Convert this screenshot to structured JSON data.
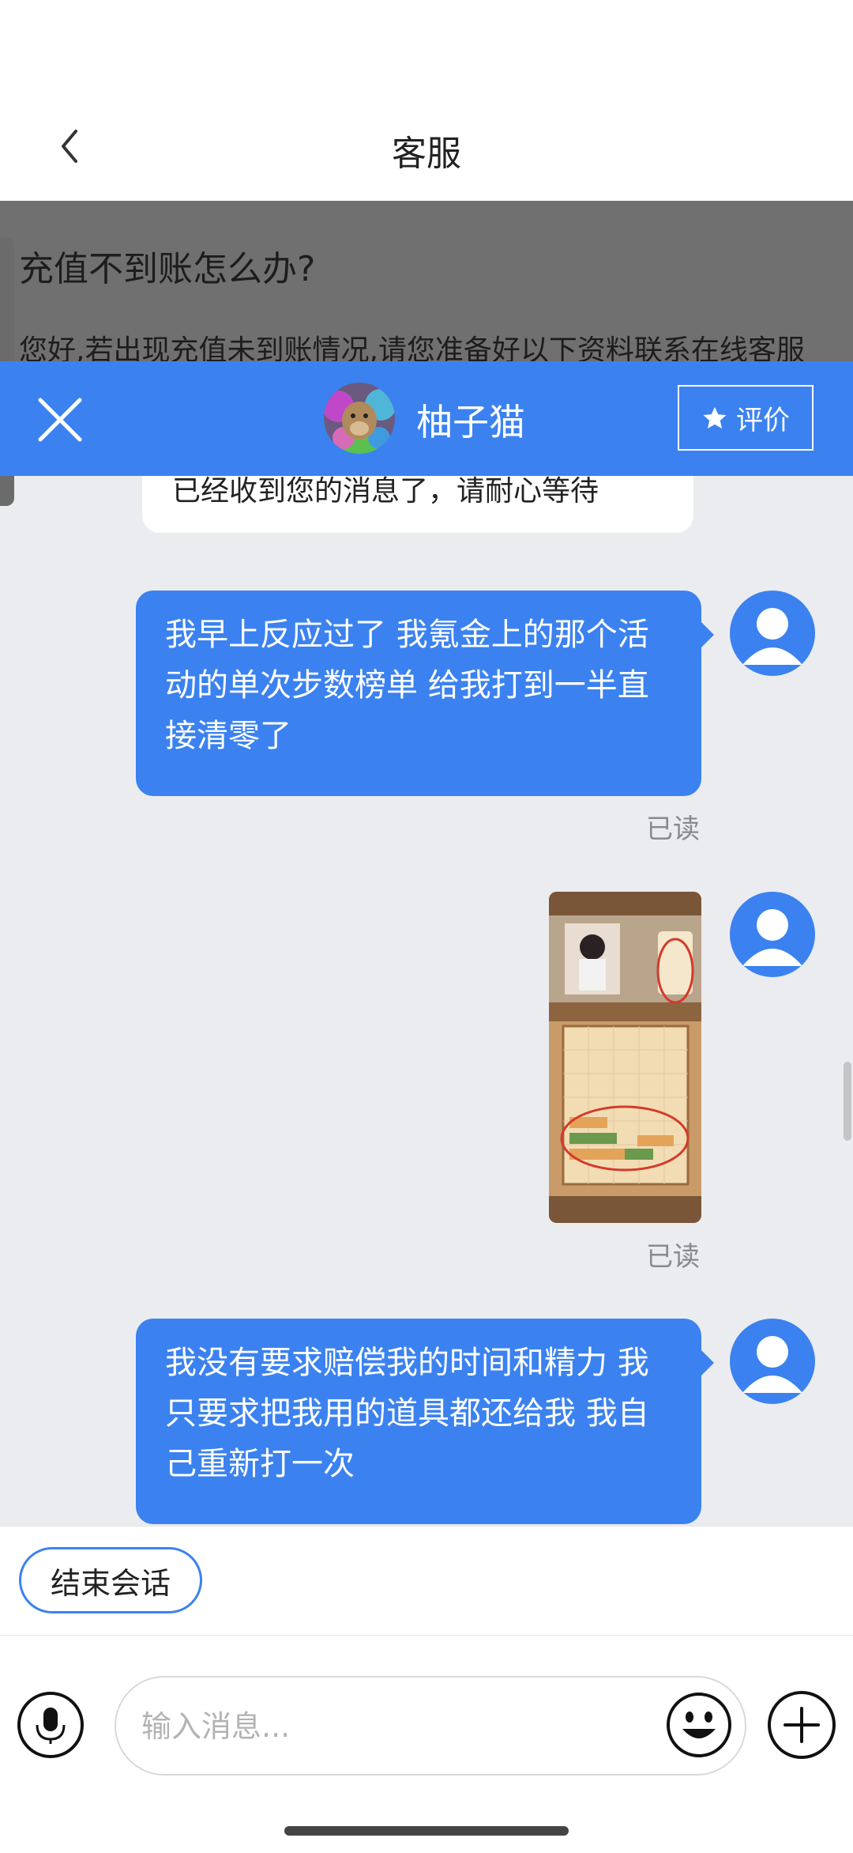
{
  "header": {
    "title": "客服"
  },
  "faq": {
    "question": "充值不到账怎么办?",
    "answer": "您好,若出现充值未到账情况,请您准备好以下资料联系在线客服"
  },
  "agent": {
    "name": "柚子猫",
    "rate_label": "评价"
  },
  "messages": [
    {
      "from": "agent",
      "text": "已经收到您的消息了，请耐心等待"
    },
    {
      "from": "user",
      "lines": [
        "我早上反应过了 我氪金上的那个活",
        "动的单次步数榜单 给我打到一半直",
        "接清零了"
      ],
      "status": "已读"
    },
    {
      "from": "user",
      "type": "image",
      "status": "已读"
    },
    {
      "from": "user",
      "lines": [
        "我没有要求赔偿我的时间和精力 我",
        "只要求把我用的道具都还给我 我自",
        "己重新打一次"
      ]
    }
  ],
  "actions": {
    "end_session": "结束会话"
  },
  "input": {
    "placeholder": "输入消息...",
    "value": ""
  },
  "colors": {
    "primary": "#3b82f0",
    "background": "#ebecf0"
  },
  "icons": [
    "back-icon",
    "close-icon",
    "star-icon",
    "microphone-icon",
    "emoji-icon",
    "plus-icon"
  ]
}
